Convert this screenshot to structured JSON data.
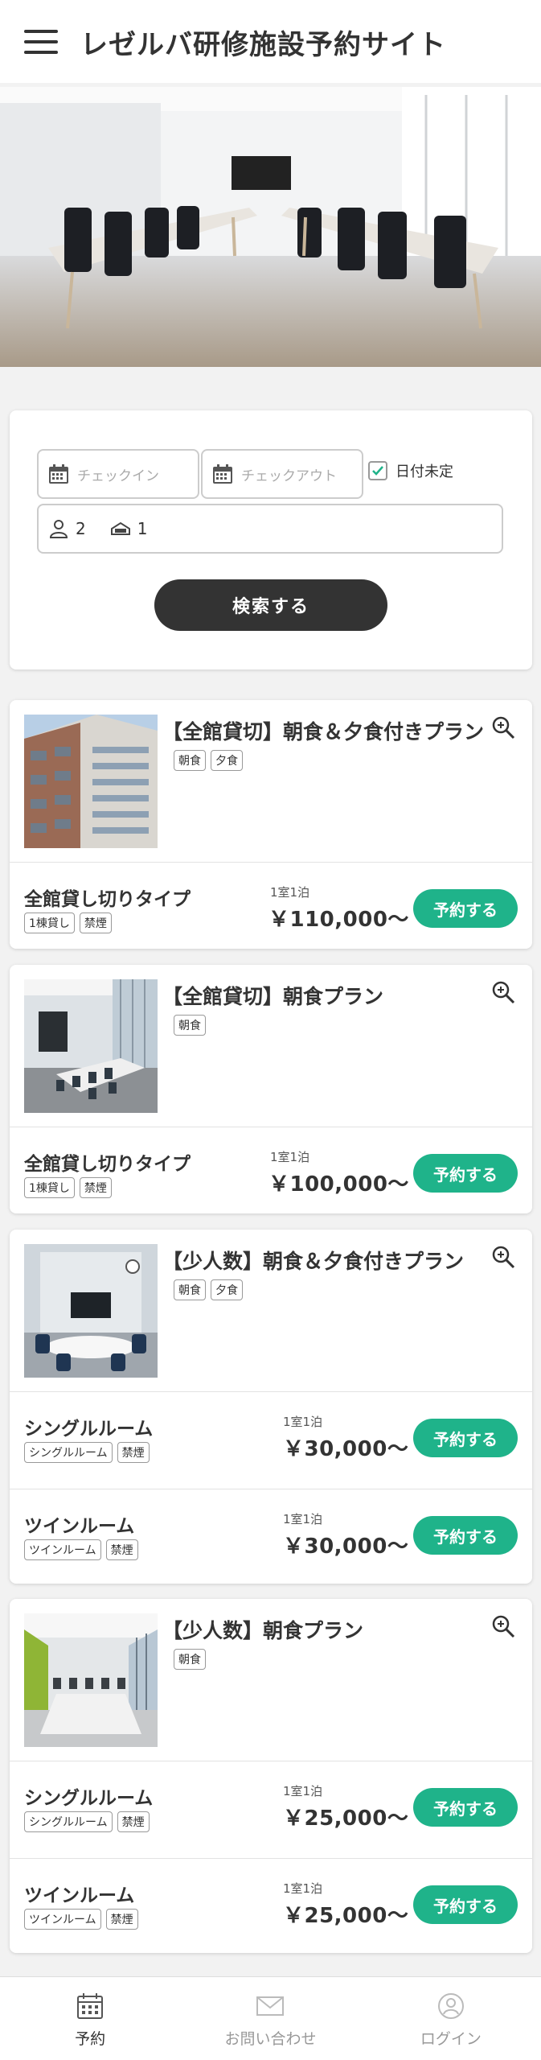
{
  "header": {
    "title": "レゼルバ研修施設予約サイト"
  },
  "search": {
    "checkin_placeholder": "チェックイン",
    "checkout_placeholder": "チェックアウト",
    "undecided_label": "日付未定",
    "undecided_checked": true,
    "guests": "2",
    "rooms": "1",
    "button_label": "検索する"
  },
  "plans": [
    {
      "title": "【全館貸切】朝食＆夕食付きプラン",
      "tags": [
        "朝食",
        "夕食"
      ],
      "rooms": [
        {
          "name": "全館貸し切りタイプ",
          "tags": [
            "1棟貸し",
            "禁煙"
          ],
          "per": "1室1泊",
          "price": "￥110,000〜",
          "button": "予約する"
        }
      ]
    },
    {
      "title": "【全館貸切】朝食プラン",
      "tags": [
        "朝食"
      ],
      "rooms": [
        {
          "name": "全館貸し切りタイプ",
          "tags": [
            "1棟貸し",
            "禁煙"
          ],
          "per": "1室1泊",
          "price": "￥100,000〜",
          "button": "予約する"
        }
      ]
    },
    {
      "title": "【少人数】朝食＆夕食付きプラン",
      "tags": [
        "朝食",
        "夕食"
      ],
      "rooms": [
        {
          "name": "シングルルーム",
          "tags": [
            "シングルルーム",
            "禁煙"
          ],
          "per": "1室1泊",
          "price": "￥30,000〜",
          "button": "予約する"
        },
        {
          "name": "ツインルーム",
          "tags": [
            "ツインルーム",
            "禁煙"
          ],
          "per": "1室1泊",
          "price": "￥30,000〜",
          "button": "予約する"
        }
      ]
    },
    {
      "title": "【少人数】朝食プラン",
      "tags": [
        "朝食"
      ],
      "rooms": [
        {
          "name": "シングルルーム",
          "tags": [
            "シングルルーム",
            "禁煙"
          ],
          "per": "1室1泊",
          "price": "￥25,000〜",
          "button": "予約する"
        },
        {
          "name": "ツインルーム",
          "tags": [
            "ツインルーム",
            "禁煙"
          ],
          "per": "1室1泊",
          "price": "￥25,000〜",
          "button": "予約する"
        }
      ]
    }
  ],
  "bottom_nav": [
    {
      "label": "予約",
      "icon": "calendar-icon",
      "active": true
    },
    {
      "label": "お問い合わせ",
      "icon": "mail-icon",
      "active": false
    },
    {
      "label": "ログイン",
      "icon": "user-icon",
      "active": false
    }
  ],
  "colors": {
    "accent": "#1fb38a",
    "dark_button": "#333333"
  }
}
